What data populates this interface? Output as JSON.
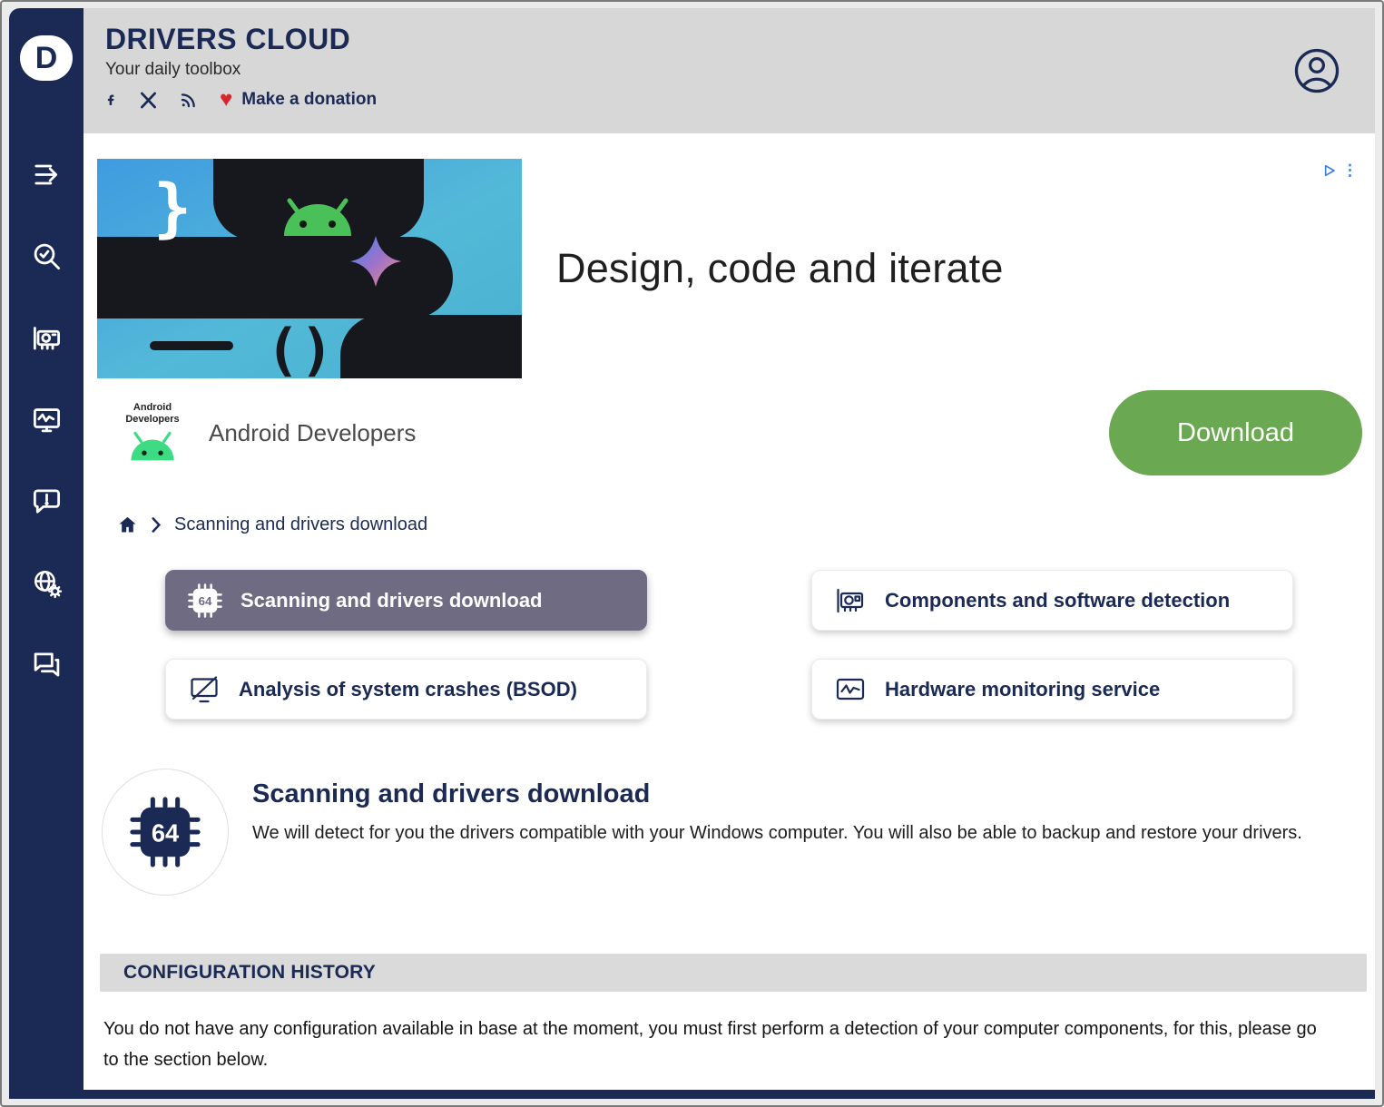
{
  "header": {
    "logo_letter": "D",
    "title": "DRIVERS CLOUD",
    "subtitle": "Your daily toolbox",
    "donation": "Make a donation"
  },
  "ad": {
    "headline": "Design, code and iterate",
    "advertiser": "Android Developers",
    "avatar_caption": "Android Developers",
    "cta": "Download"
  },
  "breadcrumb": {
    "current": "Scanning and drivers download"
  },
  "nav_buttons": [
    {
      "label": "Scanning and drivers download",
      "active": true,
      "icon": "cpu-64-icon"
    },
    {
      "label": "Components and software detection",
      "active": false,
      "icon": "gpu-card-icon"
    },
    {
      "label": "Analysis of system crashes (BSOD)",
      "active": false,
      "icon": "crashed-monitor-icon"
    },
    {
      "label": "Hardware monitoring service",
      "active": false,
      "icon": "monitor-graph-icon"
    }
  ],
  "section": {
    "title": "Scanning and drivers download",
    "description": "We will detect for you the drivers compatible with your Windows computer. You will also be able to backup and restore your drivers.",
    "chip_label": "64"
  },
  "history": {
    "heading": "CONFIGURATION HISTORY",
    "empty_message": "You do not have any configuration available in base at the moment, you must first perform a detection of your computer components, for this, please go to the section below."
  },
  "sidebar_icons": [
    "expand-menu-icon",
    "search-check-icon",
    "gpu-card-icon",
    "monitor-pulse-icon",
    "feedback-bubble-icon",
    "globe-gear-icon",
    "forum-icon"
  ],
  "header_icons": [
    "facebook-icon",
    "x-icon",
    "rss-icon",
    "heart-icon",
    "profile-icon"
  ],
  "colors": {
    "navy": "#1b2a55",
    "header_gray": "#d7d7d7",
    "download_green": "#6aa852",
    "active_button": "#6f6b82",
    "heart_red": "#d9252e",
    "ad_badge_blue": "#3d7de0"
  }
}
